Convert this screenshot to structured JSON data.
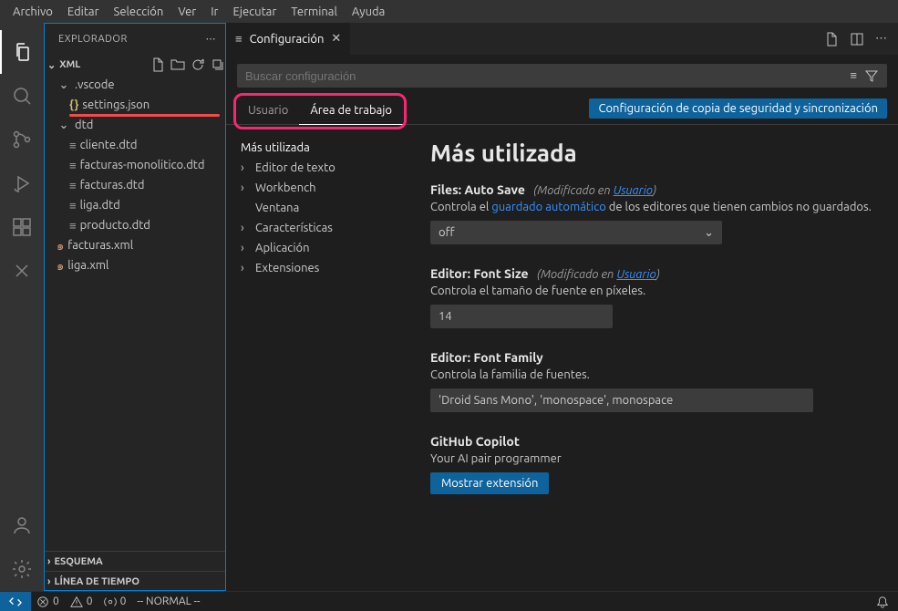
{
  "menu": [
    "Archivo",
    "Editar",
    "Selección",
    "Ver",
    "Ir",
    "Ejecutar",
    "Terminal",
    "Ayuda"
  ],
  "sidebar": {
    "title": "EXPLORADOR",
    "project": "XML",
    "tree": {
      "vscode": ".vscode",
      "settings": "settings.json",
      "dtd": "dtd",
      "files_dtd": [
        "cliente.dtd",
        "facturas-monolitico.dtd",
        "facturas.dtd",
        "liga.dtd",
        "producto.dtd"
      ],
      "files_xml": [
        "facturas.xml",
        "liga.xml"
      ]
    },
    "sections": {
      "outline": "ESQUEMA",
      "timeline": "LÍNEA DE TIEMPO"
    }
  },
  "tab": {
    "label": "Configuración"
  },
  "search": {
    "placeholder": "Buscar configuración"
  },
  "scopes": {
    "user": "Usuario",
    "workspace": "Área de trabajo"
  },
  "syncBtn": "Configuración de copia de seguridad y sincronización",
  "toc": [
    "Más utilizada",
    "Editor de texto",
    "Workbench",
    "Ventana",
    "Características",
    "Aplicación",
    "Extensiones"
  ],
  "content": {
    "heading": "Más utilizada",
    "autoSave": {
      "prefix": "Files:",
      "name": "Auto Save",
      "modifiedPrefix": "(Modificado en ",
      "modifiedLink": "Usuario",
      "modifiedSuffix": ")",
      "descA": "Controla el ",
      "descLink": "guardado automático",
      "descB": " de los editores que tienen cambios no guardados.",
      "value": "off"
    },
    "fontSize": {
      "prefix": "Editor:",
      "name": "Font Size",
      "modifiedPrefix": "(Modificado en ",
      "modifiedLink": "Usuario",
      "modifiedSuffix": ")",
      "desc": "Controla el tamaño de fuente en píxeles.",
      "value": "14"
    },
    "fontFamily": {
      "prefix": "Editor:",
      "name": "Font Family",
      "desc": "Controla la familia de fuentes.",
      "value": "'Droid Sans Mono', 'monospace', monospace"
    },
    "copilot": {
      "title": "GitHub Copilot",
      "desc": "Your AI pair programmer",
      "btn": "Mostrar extensión"
    }
  },
  "status": {
    "errors": "0",
    "warnings": "0",
    "ports": "0",
    "mode": "-- NORMAL --"
  }
}
